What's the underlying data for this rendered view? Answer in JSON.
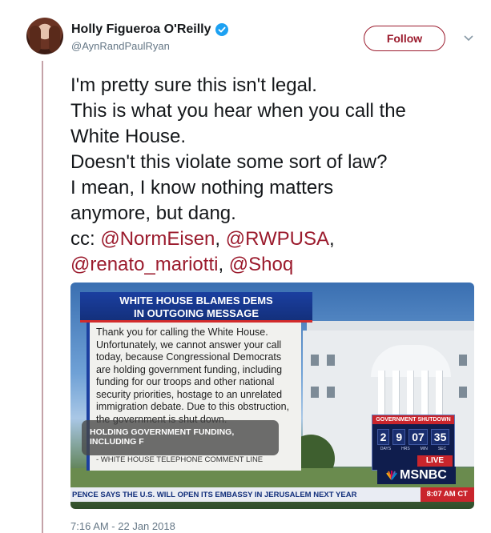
{
  "author": {
    "name": "Holly Figueroa O'Reilly",
    "handle": "@AynRandPaulRyan"
  },
  "actions": {
    "follow_label": "Follow"
  },
  "tweet": {
    "lines": [
      "I'm pretty sure this isn't legal.",
      "This is what you hear when you call the",
      "White House.",
      "Doesn't this violate some sort of law?",
      "I mean, I know nothing matters",
      "anymore, but dang."
    ],
    "cc_prefix": "cc: ",
    "mentions": [
      "@NormEisen",
      "@RWPUSA",
      "@renato_mariotti",
      "@Shoq"
    ],
    "separators": [
      ", ",
      ",",
      ", "
    ]
  },
  "media": {
    "headline_line1": "WHITE HOUSE BLAMES DEMS",
    "headline_line2": "IN OUTGOING MESSAGE",
    "message": "Thank you for calling the White House. Unfortunately, we cannot answer your call today, because Congressional Democrats are holding government funding, including funding for our troops and other national security priorities, hostage to an unrelated immigration debate. Due to this obstruction, the government is shut down.",
    "message_source": "- WHITE HOUSE TELEPHONE COMMENT LINE",
    "funding_box": "HOLDING GOVERNMENT FUNDING, INCLUDING F",
    "shutdown_label": "GOVERNMENT SHUTDOWN",
    "clock": [
      "2",
      "9",
      "07",
      "35"
    ],
    "clock_units": [
      "DAYS",
      "HRS",
      "MIN",
      "SEC"
    ],
    "live_label": "LIVE",
    "network": "MSNBC",
    "ticker_text": "PENCE SAYS THE U.S. WILL OPEN ITS EMBASSY IN JERUSALEM NEXT YEAR",
    "ticker_time": "8:07 AM CT"
  },
  "meta": {
    "timestamp": "7:16 AM - 22 Jan 2018"
  },
  "colors": {
    "accent": "#9b1b2d",
    "verified": "#1da1f2",
    "muted": "#657786"
  }
}
